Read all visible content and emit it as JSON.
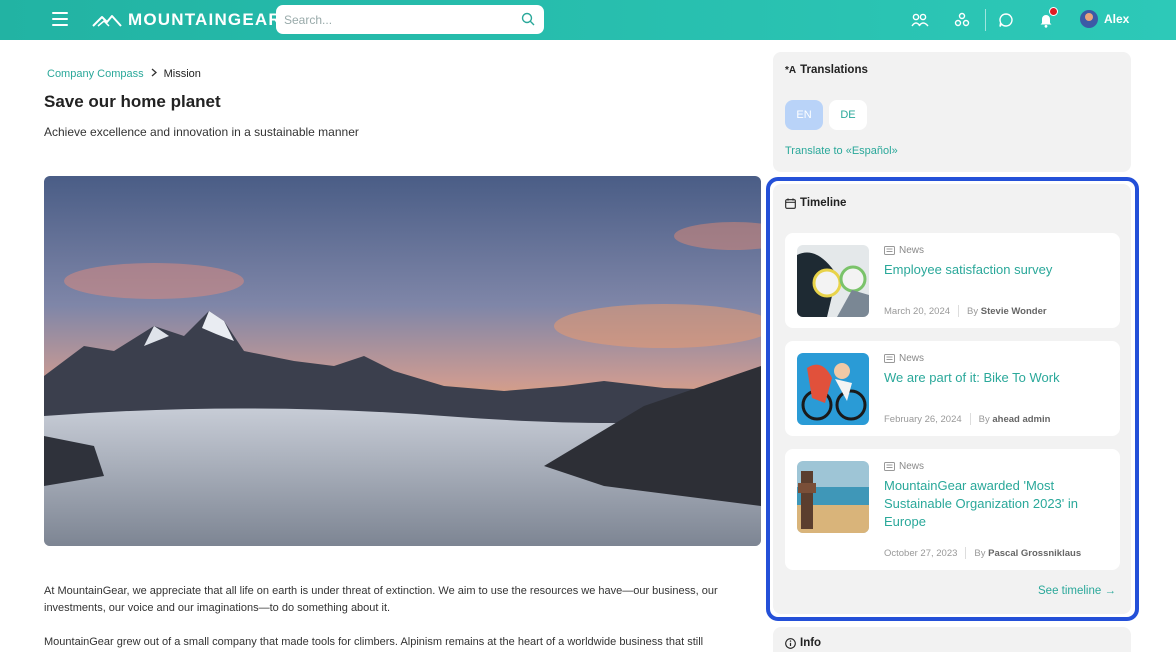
{
  "header": {
    "brand": "MOUNTAINGEAR",
    "search_placeholder": "Search...",
    "user_name": "Alex",
    "icons": [
      "menu-icon",
      "people-icon",
      "org-icon",
      "chat-icon",
      "bell-icon",
      "search-icon"
    ],
    "colors": {
      "bar": "#2dc9b8",
      "accent": "#2aa89a",
      "notification": "#e01b24"
    }
  },
  "breadcrumb": {
    "parent": "Company Compass",
    "current": "Mission"
  },
  "page": {
    "title": "Save our home planet",
    "subtitle": "Achieve excellence and innovation in a sustainable manner",
    "paragraphs": [
      "At MountainGear, we appreciate that all life on earth is under threat of extinction. We aim to use the resources we have—our business, our investments, our voice and our imaginations—to do something about it.",
      "MountainGear grew out of a small company that made tools for climbers. Alpinism remains at the heart of a worldwide business that still"
    ]
  },
  "translations": {
    "title": "Translations",
    "languages": [
      "EN",
      "DE"
    ],
    "selected": "EN",
    "translate_link": "Translate to «Español»"
  },
  "timeline": {
    "title": "Timeline",
    "items": [
      {
        "type": "News",
        "title": "Employee satisfaction survey",
        "date": "March 20, 2024",
        "by": "By",
        "author": "Stevie Wonder"
      },
      {
        "type": "News",
        "title": "We are part of it: Bike To Work",
        "date": "February 26, 2024",
        "by": "By",
        "author": "ahead admin"
      },
      {
        "type": "News",
        "title": "MountainGear awarded 'Most Sustainable Organization 2023' in Europe",
        "date": "October 27, 2023",
        "by": "By",
        "author": "Pascal Grossniklaus"
      }
    ],
    "see_link": "See timeline →"
  },
  "info": {
    "title": "Info"
  }
}
